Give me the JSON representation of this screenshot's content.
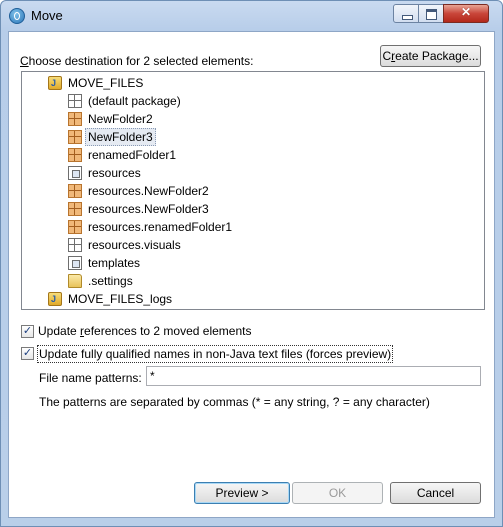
{
  "window": {
    "title": "Move",
    "icon": "app-icon"
  },
  "dialog": {
    "destination_label": "Choose destination for 2 selected elements:",
    "create_package_button": "Create Package...",
    "tree": [
      {
        "label": "MOVE_FILES",
        "icon": "java-project-icon",
        "level": 0
      },
      {
        "label": "(default package)",
        "icon": "package-icon",
        "level": 1
      },
      {
        "label": "NewFolder2",
        "icon": "package-orange-icon",
        "level": 1
      },
      {
        "label": "NewFolder3",
        "icon": "package-orange-icon",
        "level": 1,
        "selected": true
      },
      {
        "label": "renamedFolder1",
        "icon": "package-orange-icon",
        "level": 1
      },
      {
        "label": "resources",
        "icon": "resource-package-icon",
        "level": 1
      },
      {
        "label": "resources.NewFolder2",
        "icon": "package-orange-icon",
        "level": 1
      },
      {
        "label": "resources.NewFolder3",
        "icon": "package-orange-icon",
        "level": 1
      },
      {
        "label": "resources.renamedFolder1",
        "icon": "package-orange-icon",
        "level": 1
      },
      {
        "label": "resources.visuals",
        "icon": "package-icon",
        "level": 1
      },
      {
        "label": "templates",
        "icon": "resource-package-icon",
        "level": 1
      },
      {
        "label": ".settings",
        "icon": "folder-icon",
        "level": 1
      },
      {
        "label": "MOVE_FILES_logs",
        "icon": "java-project-icon",
        "level": 0
      }
    ],
    "update_references": {
      "label": "Update references to 2 moved elements",
      "checked": true
    },
    "update_qualified": {
      "label": "Update fully qualified names in non-Java text files (forces preview)",
      "checked": true
    },
    "file_name_patterns_label": "File name patterns:",
    "file_name_patterns_value": "*",
    "patterns_hint": "The patterns are separated by commas (* = any string, ? = any character)",
    "buttons": {
      "preview": "Preview >",
      "ok": "OK",
      "cancel": "Cancel"
    }
  }
}
